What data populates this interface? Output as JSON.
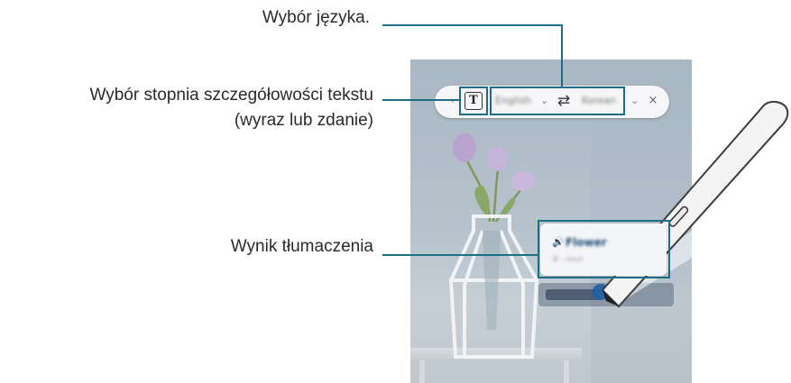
{
  "callouts": {
    "language": "Wybór języka.",
    "granularity_line1": "Wybór stopnia szczegółowości tekstu",
    "granularity_line2": "(wyraz lub zdanie)",
    "result": "Wynik tłumaczenia"
  },
  "toolbar": {
    "handle_icon": "drag-handle-icon",
    "text_mode_icon": "T",
    "source_language": "English",
    "swap_icon": "⇄",
    "target_language": "Korean",
    "close_icon": "×"
  },
  "result_card": {
    "word": "Flower",
    "detail": "꽃 · noun"
  },
  "colors": {
    "leader": "#1d6f86",
    "phone_bg": "#b7c3cd",
    "pen_highlight": "#1e5fa8"
  }
}
